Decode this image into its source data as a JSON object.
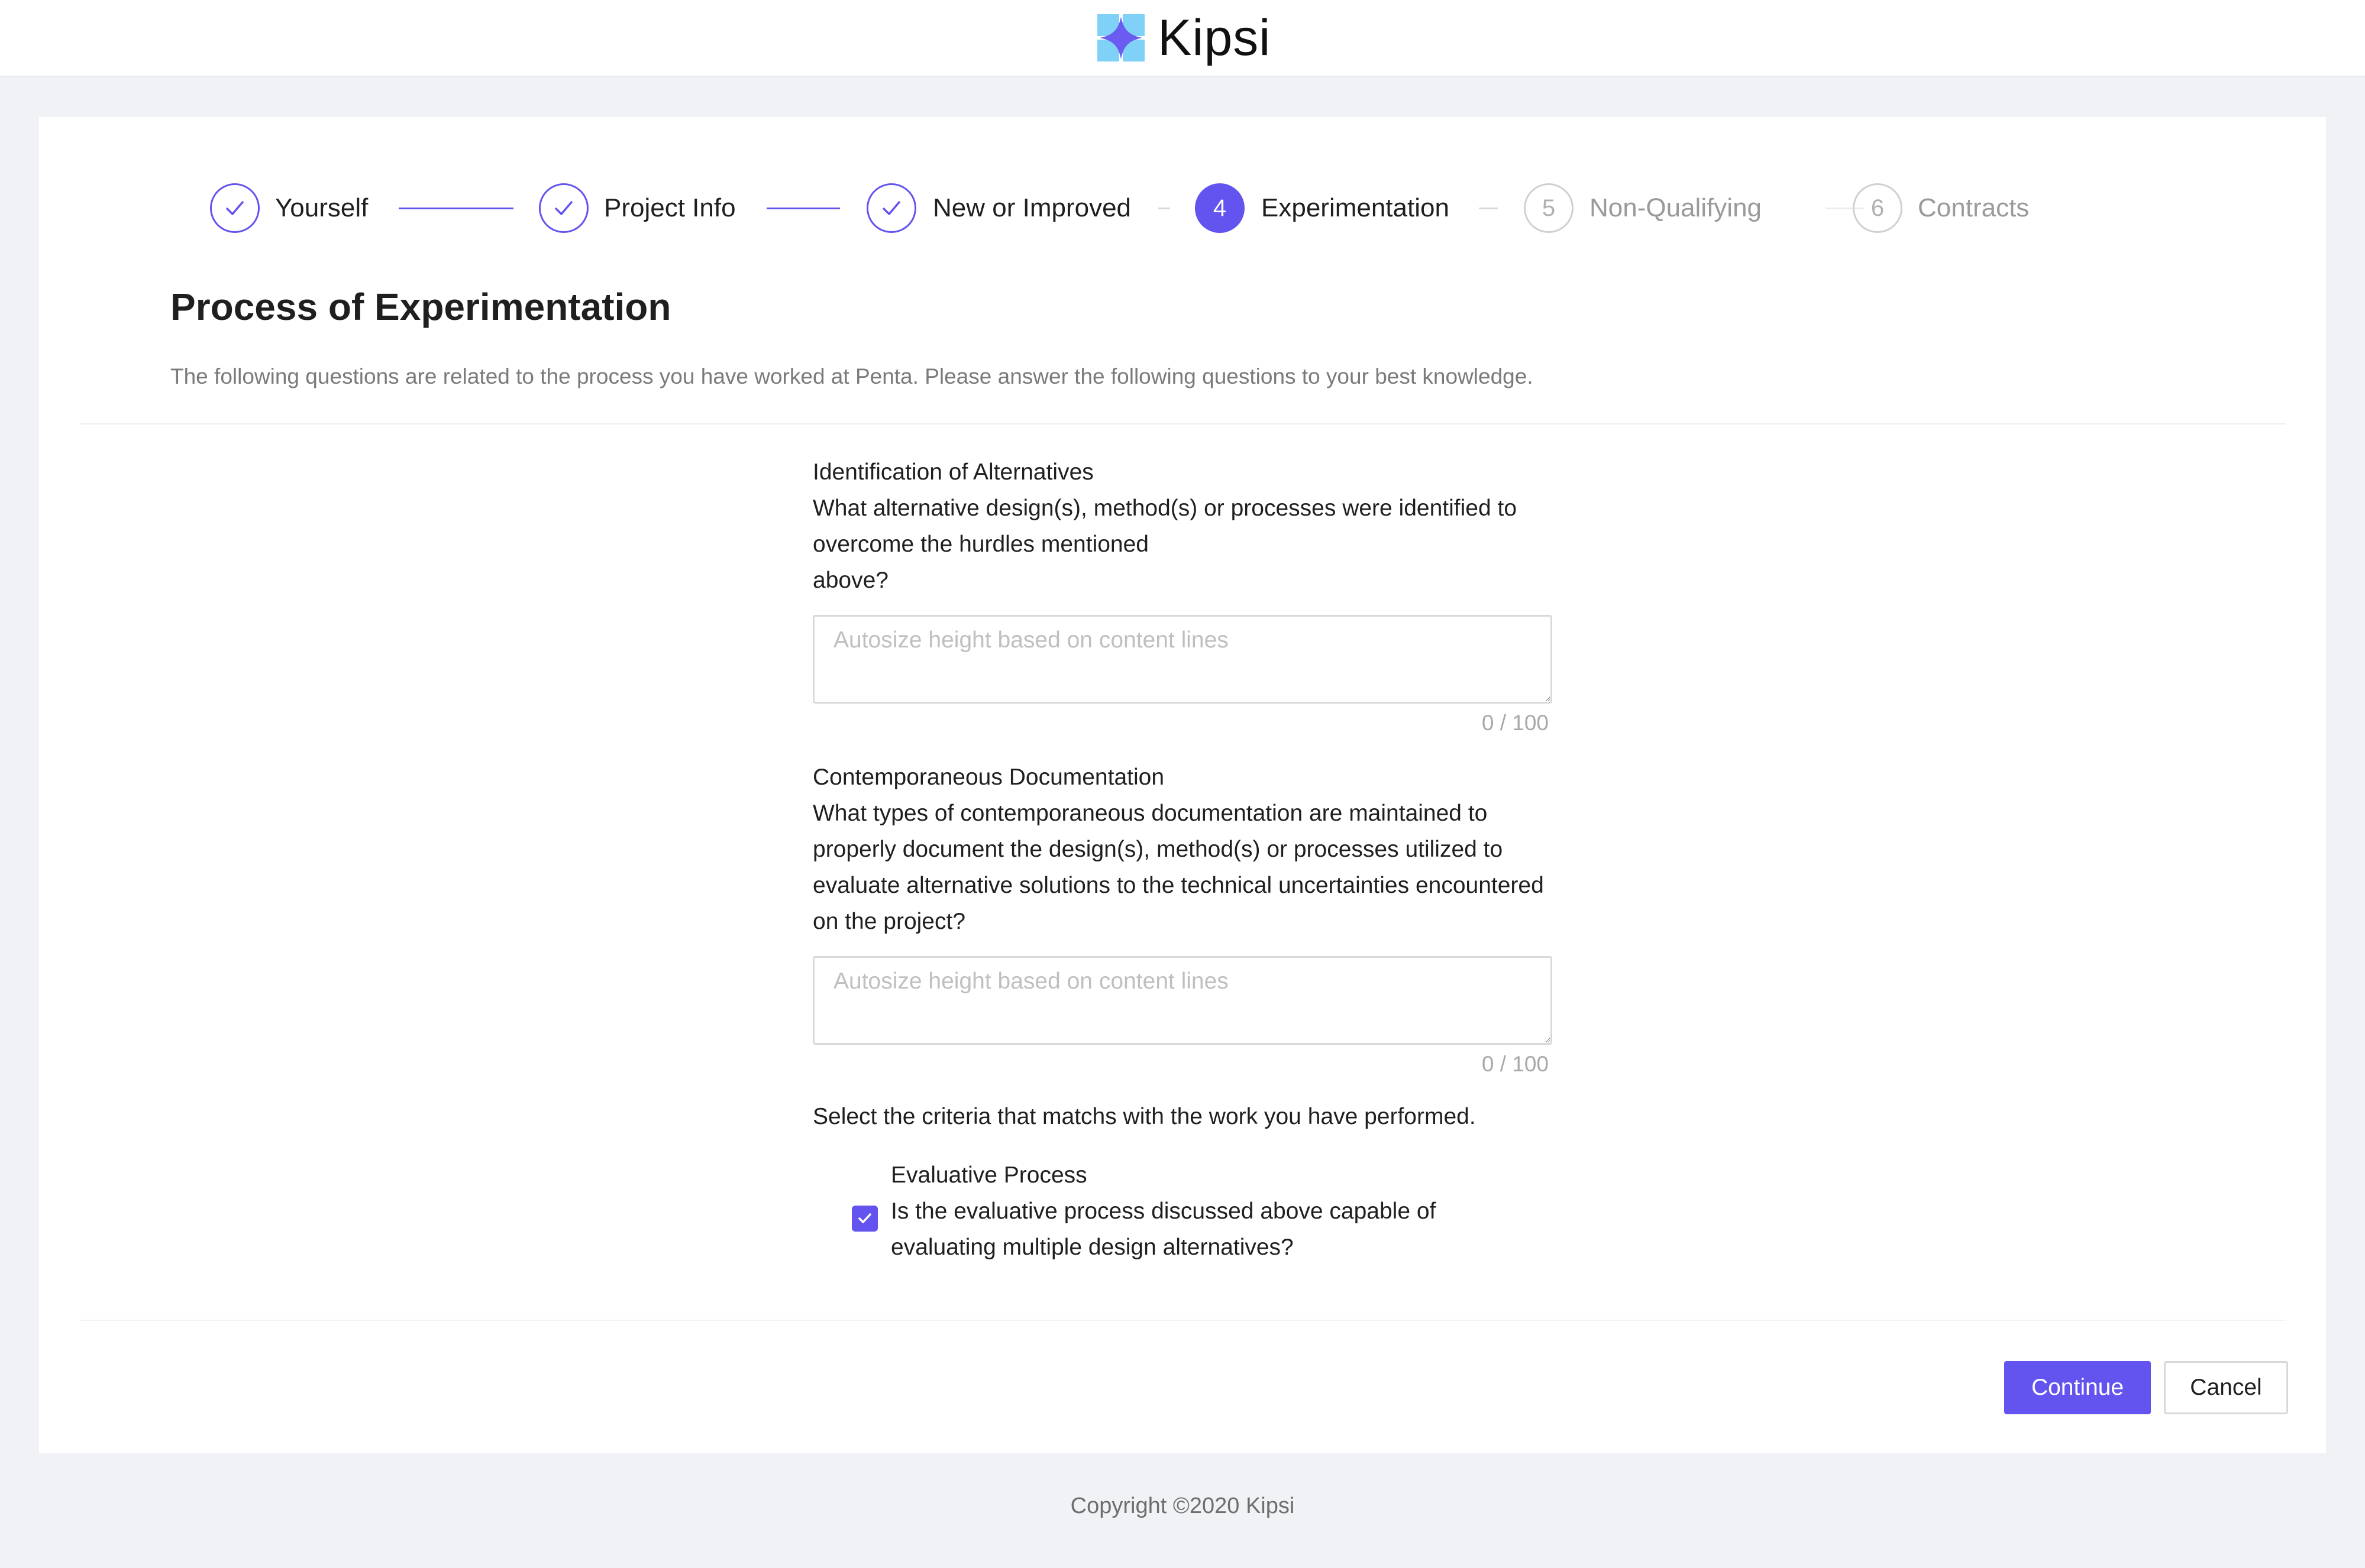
{
  "header": {
    "brand_name": "Kipsi",
    "logo_icon": "kipsi-logo-icon",
    "colors": {
      "logo_light": "#7fd1f7",
      "logo_dark": "#6a5cf0"
    }
  },
  "steps": [
    {
      "label": "Yourself",
      "status": "done",
      "icon": "check-icon"
    },
    {
      "label": "Project Info",
      "status": "done",
      "icon": "check-icon"
    },
    {
      "label": "New or Improved",
      "status": "done",
      "icon": "check-icon"
    },
    {
      "label": "Experimentation",
      "status": "active",
      "number": "4"
    },
    {
      "label": "Non-Qualifying",
      "status": "pending",
      "number": "5"
    },
    {
      "label": "Contracts",
      "status": "pending",
      "number": "6"
    }
  ],
  "page": {
    "title": "Process of Experimentation",
    "description": "The following questions are related to the process you have worked at Penta. Please answer the following questions to your best knowledge."
  },
  "questions": [
    {
      "lines": [
        "Identification of Alternatives",
        "What alternative design(s), method(s) or processes were identified to",
        "overcome the hurdles mentioned",
        "above?"
      ],
      "placeholder": "Autosize height based on content lines",
      "value": "",
      "counter": "0 / 100"
    },
    {
      "lines": [
        "Contemporaneous Documentation",
        "What types of contemporaneous documentation are maintained to",
        "properly document the design(s), method(s) or processes utilized to",
        "evaluate alternative solutions to the technical uncertainties encountered",
        "on the project?"
      ],
      "placeholder": "Autosize height based on content lines",
      "value": "",
      "counter": "0 / 100"
    }
  ],
  "criteria": {
    "prompt": "Select the criteria that matchs with the work you have performed.",
    "items": [
      {
        "lines": [
          "Evaluative Process",
          "Is the evaluative process discussed above capable of",
          "evaluating multiple design alternatives?"
        ],
        "checked": true
      }
    ]
  },
  "actions": {
    "continue_label": "Continue",
    "cancel_label": "Cancel"
  },
  "footer": {
    "copyright": "Copyright ©2020 Kipsi"
  },
  "colors": {
    "accent": "#6454ef",
    "page_background": "#f0f2f5"
  }
}
